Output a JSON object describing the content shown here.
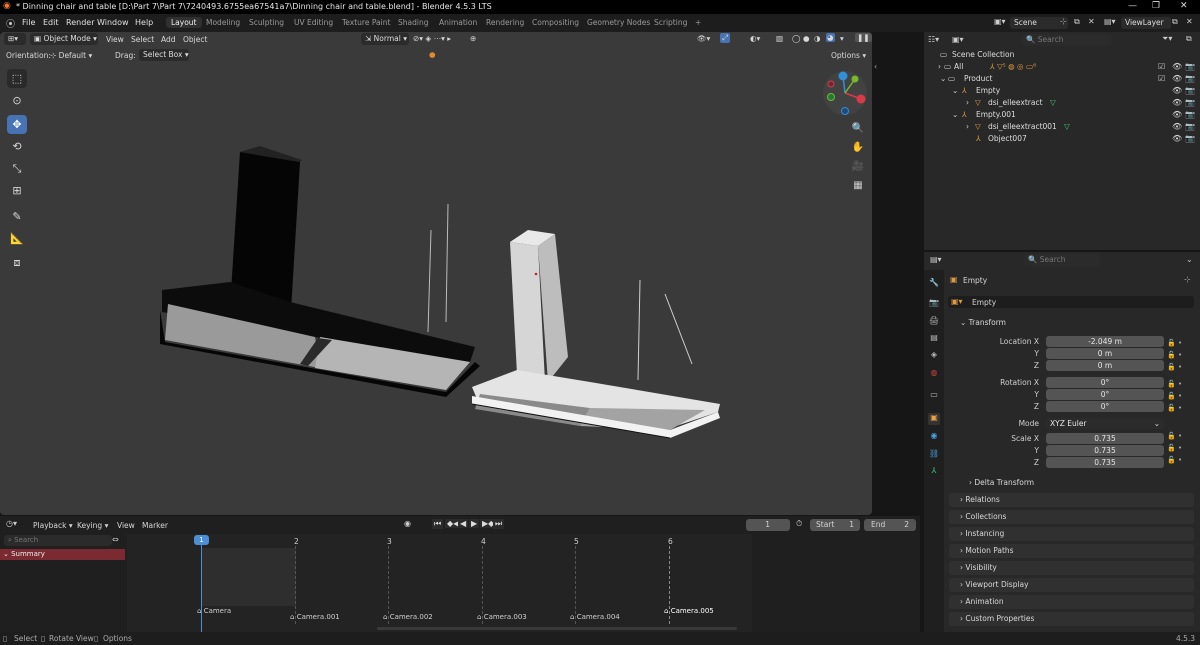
{
  "window": {
    "title": "* Dinning chair and table [D:\\Part 7\\Part 7\\7240493.6755ea67541a7\\Dinning chair and table.blend] - Blender 4.5.3 LTS",
    "minimize": "—",
    "maximize": "❐",
    "close": "✕"
  },
  "menu": [
    "File",
    "Edit",
    "Render",
    "Window",
    "Help"
  ],
  "workspaces": [
    "Layout",
    "Modeling",
    "Sculpting",
    "UV Editing",
    "Texture Paint",
    "Shading",
    "Animation",
    "Rendering",
    "Compositing",
    "Geometry Nodes",
    "Scripting",
    "+"
  ],
  "active_workspace": "Layout",
  "scene": {
    "name": "Scene",
    "view_layer": "ViewLayer"
  },
  "viewport": {
    "mode": "Object Mode",
    "menus": [
      "View",
      "Select",
      "Add",
      "Object"
    ],
    "orientation_label": "Orientation:",
    "orientation_value": "Default",
    "drag_label": "Drag:",
    "drag_value": "Select Box",
    "pivot": "Normal",
    "options": "Options",
    "gizmo_axes": [
      "Y",
      "X",
      "Z"
    ]
  },
  "tools": [
    "select-box",
    "cursor",
    "move",
    "rotate",
    "scale",
    "transform",
    "annotate",
    "measure",
    "add-cube"
  ],
  "outliner": {
    "search_placeholder": "Search",
    "items": [
      {
        "label": "Scene Collection",
        "indent": 0
      },
      {
        "label": "All",
        "indent": 1
      },
      {
        "label": "Product",
        "indent": 1
      },
      {
        "label": "Empty",
        "indent": 2
      },
      {
        "label": "dsi_elleextract",
        "indent": 3
      },
      {
        "label": "Empty.001",
        "indent": 2
      },
      {
        "label": "dsi_elleextract001",
        "indent": 3
      },
      {
        "label": "Object007",
        "indent": 3
      }
    ]
  },
  "properties": {
    "search_placeholder": "Search",
    "object_name": "Empty",
    "data_name": "Empty",
    "transform_header": "Transform",
    "location_label": "Location X",
    "location": [
      "-2.049 m",
      "0 m",
      "0 m"
    ],
    "rotation_label": "Rotation X",
    "rotation": [
      "0°",
      "0°",
      "0°"
    ],
    "mode_label": "Mode",
    "mode_value": "XYZ Euler",
    "scale_label": "Scale X",
    "scale": [
      "0.735",
      "0.735",
      "0.735"
    ],
    "axis_y": "Y",
    "axis_z": "Z",
    "delta_transform": "Delta Transform",
    "panels": [
      "Relations",
      "Collections",
      "Instancing",
      "Motion Paths",
      "Visibility",
      "Viewport Display",
      "Animation",
      "Custom Properties"
    ]
  },
  "timeline": {
    "menus": [
      "Playback",
      "Keying",
      "View",
      "Marker"
    ],
    "current_frame": "1",
    "start_label": "Start",
    "start": "1",
    "end_label": "End",
    "end": "2",
    "search_placeholder": "Search",
    "summary": "Summary",
    "frames": [
      "2",
      "3",
      "4",
      "5",
      "6"
    ],
    "current_marker": "1",
    "cameras": [
      "Camera",
      "Camera.001",
      "Camera.002",
      "Camera.003",
      "Camera.004",
      "Camera.005"
    ]
  },
  "statusbar": {
    "select": "Select",
    "rotate": "Rotate View",
    "options": "Options",
    "version": "4.5.3"
  }
}
